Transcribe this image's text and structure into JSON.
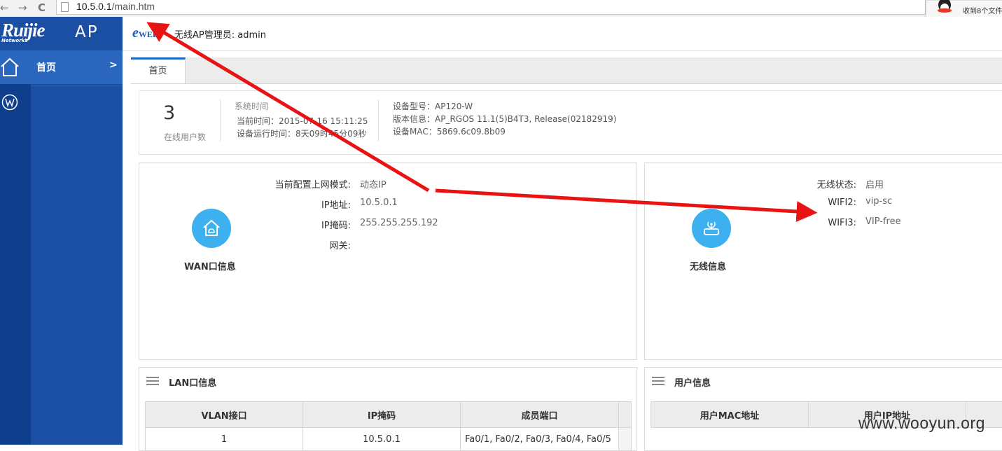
{
  "browser": {
    "nav_back": "←",
    "nav_forward": "→",
    "nav_reload": "C",
    "url_host": "10.5.0.1",
    "url_path": "/main.htm",
    "notification_text": "收到8个文件"
  },
  "sidebar": {
    "brand": "Ruijie",
    "brand_sub": "Networks",
    "product": "AP",
    "items": [
      {
        "label": "首页",
        "arrow": ">"
      }
    ]
  },
  "header": {
    "logo_text": "e",
    "logo_small": "WEB",
    "title": "无线AP管理员: admin"
  },
  "tabs": [
    {
      "label": "首页",
      "active": true
    }
  ],
  "summary": {
    "online_users": "3",
    "online_users_label": "在线用户数",
    "system_time_title": "系统时间",
    "current_time": "当前时间：2015-07-16 15:11:25",
    "uptime": "设备运行时间：8天09时45分09秒",
    "device_model": "设备型号：AP120-W",
    "version": "版本信息：AP_RGOS 11.1(5)B4T3, Release(02182919)",
    "mac": "设备MAC：5869.6c09.8b09"
  },
  "wan": {
    "caption": "WAN口信息",
    "icon": "home-cloud-icon",
    "rows": [
      {
        "key": "当前配置上网模式:",
        "value": "动态IP"
      },
      {
        "key": "IP地址:",
        "value": "10.5.0.1"
      },
      {
        "key": "IP掩码:",
        "value": "255.255.255.192"
      },
      {
        "key": "网关:",
        "value": ""
      }
    ]
  },
  "wireless": {
    "caption": "无线信息",
    "icon": "router-wifi-icon",
    "rows": [
      {
        "key": "无线状态:",
        "value": "启用"
      },
      {
        "key": "WIFI2:",
        "value": "vip-sc"
      },
      {
        "key": "WIFI3:",
        "value": "VIP-free"
      }
    ]
  },
  "lan": {
    "title": "LAN口信息",
    "columns": [
      "VLAN接口",
      "IP掩码",
      "成员端口"
    ],
    "rows": [
      [
        "1",
        "10.5.0.1",
        "Fa0/1, Fa0/2, Fa0/3, Fa0/4, Fa0/5"
      ]
    ]
  },
  "users": {
    "title": "用户信息",
    "columns": [
      "用户MAC地址",
      "用户IP地址"
    ]
  },
  "watermark": "www.wooyun.org",
  "colors": {
    "sidebar": "#1b4fa3",
    "sidebar_active": "#2c67bf",
    "icon_circle": "#3db0f0",
    "arrow": "#e81313",
    "tab_accent": "#1b66c9"
  }
}
